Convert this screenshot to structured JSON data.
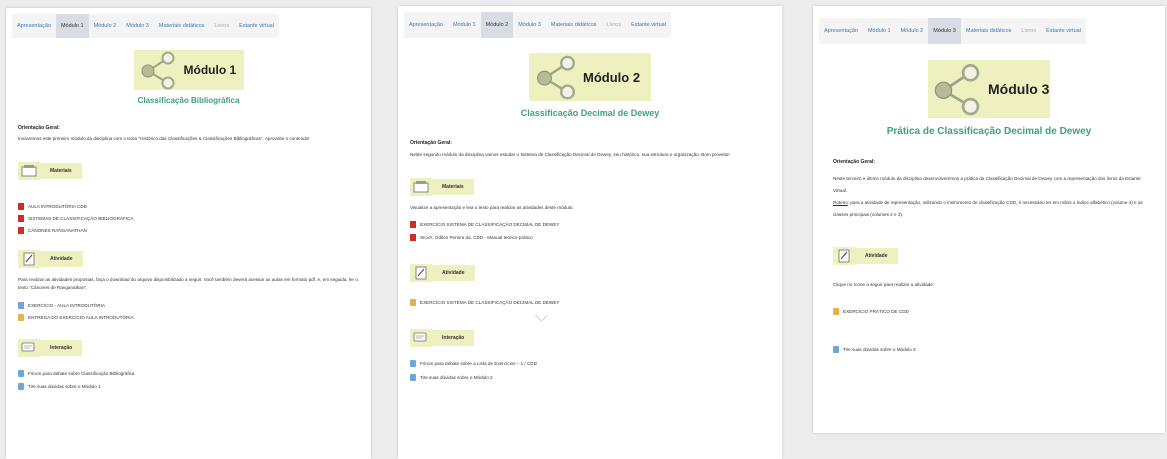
{
  "colors": {
    "accent": "#3f9f82",
    "header_bg": "#eef0bf",
    "link": "#3a7ab8"
  },
  "panel1": {
    "tabs": [
      "Apresentação",
      "Módulo 1",
      "Módulo 2",
      "Módulo 3",
      "Materiais didáticos",
      "Livros",
      "Estante virtual"
    ],
    "active_tab": 1,
    "title": "Módulo 1",
    "subtitle": "Classificação Bibliográfica",
    "orientacao_label": "Orientação Geral:",
    "orientacao_text": "Iniciaremos este primeiro módulo da disciplina com o texto \"Histórico das Classificações & Classificações Bibliográficas\". Aproveite o conteúdo!",
    "materiais_label": "Materiais",
    "materiais_items": [
      "AULA INTRODUTÓRIA CDD",
      "SISTEMAS DE CLASSIFICAÇÃO BIBLIOGRÁFICA",
      "CÂNONES RANGANATHAN"
    ],
    "atividade_label": "Atividade",
    "atividade_text": "Para realizar as atividades propostas, faça o download do arquivo disponibilizado a seguir. Você também deverá acessar as aulas em formato pdf. e, em seguida, ler o texto \"Cânones de Ranganathan\".",
    "atividade_items": [
      "EXERCÍCIO - AULA INTRODUTÓRIA",
      "ENTREGA DO EXERCÍCIO AULA INTRODUTÓRIA"
    ],
    "interacao_label": "Interação",
    "interacao_items": [
      "Fórum para debate sobre Classificação Bibliográfica",
      "Tire suas dúvidas sobre o Módulo 1"
    ]
  },
  "panel2": {
    "tabs": [
      "Apresentação",
      "Módulo 1",
      "Módulo 2",
      "Módulo 3",
      "Materiais didáticos",
      "Livros",
      "Estante virtual"
    ],
    "active_tab": 2,
    "title": "Módulo 2",
    "subtitle": "Classificação Decimal de Dewey",
    "orientacao_label": "Orientação Geral:",
    "orientacao_text": "Neste segundo módulo da disciplina vamos estudar o Sistema de Classificação Decimal de Dewey, seu histórico, sua estrutura e organização. Bom proveito!",
    "materiais_label": "Materiais",
    "materiais_text": "Visualize a apresentação e leia o texto para realizar as atividades deste módulo:",
    "materiais_items": [
      "EXERCÍCIO SISTEMA DE CLASSIFICAÇÃO DECIMAL DE DEWEY",
      "SILVA, Odilon Pereira da. CDD - Manual teórico-prático"
    ],
    "atividade_label": "Atividade",
    "atividade_items": [
      "EXERCÍCIO SISTEMA DE CLASSIFICAÇÃO DECIMAL DE DEWEY"
    ],
    "interacao_label": "Interação",
    "interacao_items": [
      "Fórum para debate sobre a Lista de Exercícios – 1 / CDD",
      "Tire suas dúvidas sobre o Módulo 2"
    ]
  },
  "panel3": {
    "tabs": [
      "Apresentação",
      "Módulo 1",
      "Módulo 2",
      "Módulo 3",
      "Materiais didáticos",
      "Livros",
      "Estante virtual"
    ],
    "active_tab": 3,
    "title": "Módulo 3",
    "subtitle": "Prática de Classificação Decimal de Dewey",
    "orientacao_label": "Orientação Geral:",
    "orientacao_text1": "Neste terceiro e último módulo da disciplina desenvolveremos a prática da Classificação Decimal de Dewey com a representação dos livros da Estante Virtual.",
    "orientacao_text2_prefix": "Roteiro",
    "orientacao_text2": ": para a atividade de representação, utilizando o instrumento de classificação CDD, é necessário ter em mãos o índice alfabético (volume 4) e as classes principais (volumes 2 e 3).",
    "atividade_label": "Atividade",
    "atividade_text": "Clique no ícone a seguir para realizar a atividade:",
    "atividade_items": [
      "EXERCÍCIO PRÁTICO DE CDD"
    ],
    "interacao_items": [
      "Tire suas dúvidas sobre o Módulo 3"
    ]
  }
}
